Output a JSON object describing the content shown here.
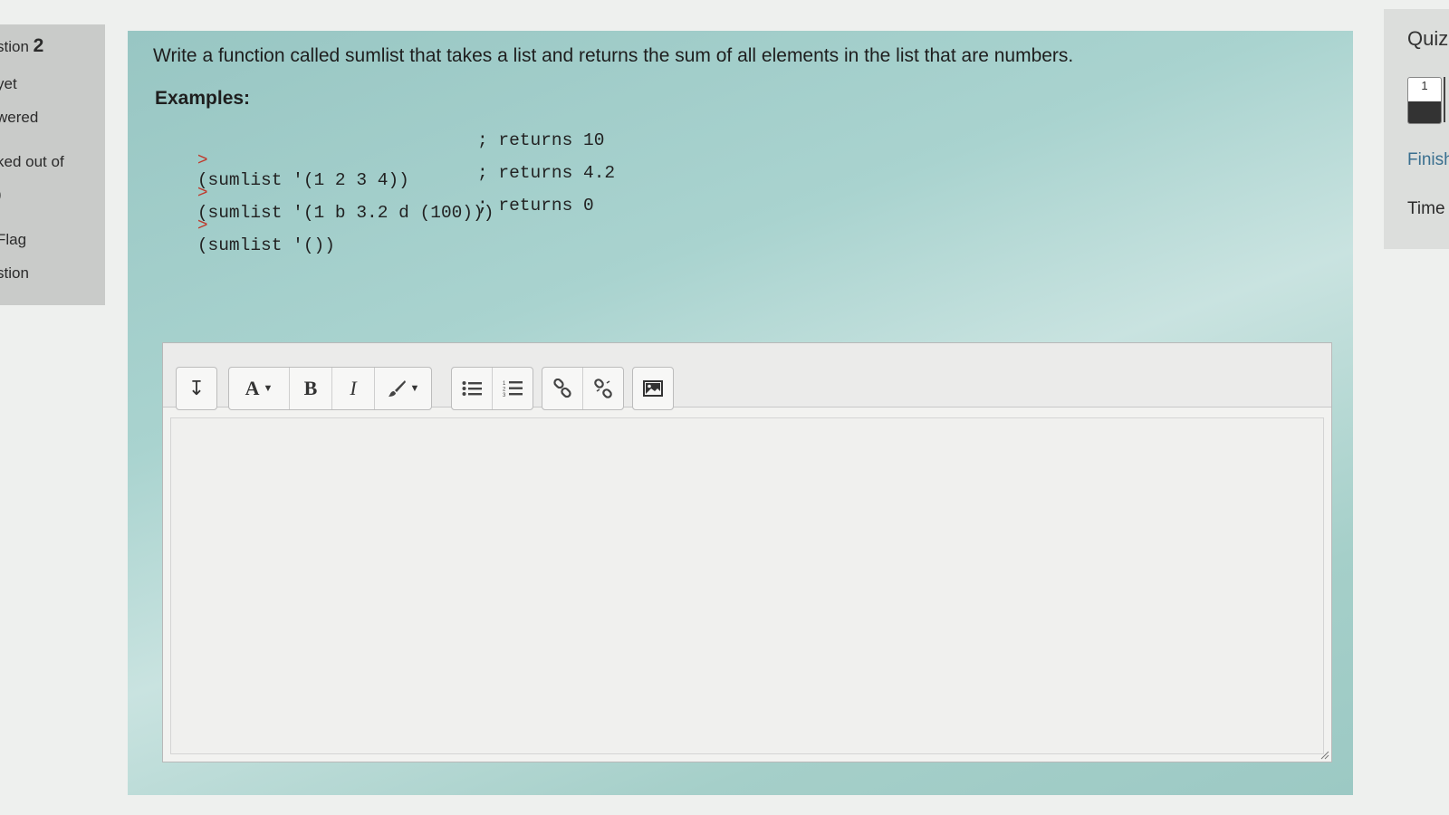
{
  "info": {
    "question_prefix": "stion",
    "question_number": "2",
    "status_line1": "yet",
    "status_line2": "wered",
    "marked_out_of": "ked out of",
    "marks": ")",
    "flag_line1": "Flag",
    "flag_line2": "stion"
  },
  "question": {
    "text": "Write a function called sumlist that takes a list and returns the sum of all elements in the list that are numbers.",
    "examples_title": "Examples:",
    "examples": [
      {
        "prompt": ">",
        "code": "(sumlist '(1 2 3 4))",
        "comment": "; returns 10"
      },
      {
        "prompt": ">",
        "code": "(sumlist '(1 b 3.2 d (100)))",
        "comment": "; returns 4.2"
      },
      {
        "prompt": ">",
        "code": "(sumlist '())",
        "comment": "; returns 0"
      }
    ]
  },
  "editor": {
    "toolbar": {
      "collapse": "↧",
      "font": "A",
      "bold": "B",
      "italic": "I"
    },
    "content": ""
  },
  "nav": {
    "title": "Quiz",
    "question_button": "1",
    "finish": "Finish",
    "time": "Time"
  }
}
